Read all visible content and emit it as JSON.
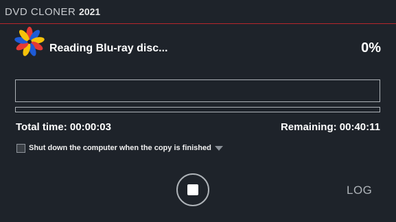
{
  "app": {
    "brand_name": "DVD CLONER",
    "brand_year": "2021",
    "accent_color": "#b8262c"
  },
  "status": {
    "message": "Reading Blu-ray disc...",
    "percent": "0%",
    "progress_value": 0
  },
  "timing": {
    "total_label": "Total time: 00:00:03",
    "remaining_label": "Remaining: 00:40:11"
  },
  "options": {
    "shutdown_label": "Shut down the computer when the copy is finished",
    "shutdown_checked": false
  },
  "controls": {
    "stop_icon": "stop-icon",
    "log_label": "LOG"
  }
}
